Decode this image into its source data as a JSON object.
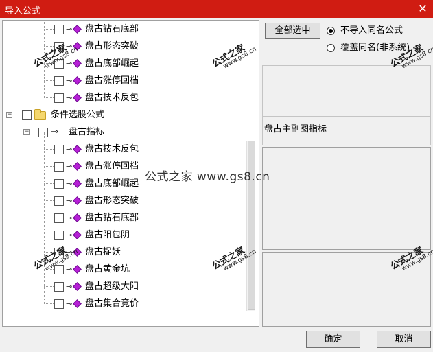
{
  "window": {
    "title": "导入公式",
    "close_glyph": "✕"
  },
  "tree": {
    "group1_items": [
      "盘古钻石底部",
      "盘古形态突破",
      "盘古底部崛起",
      "盘古涨停回档",
      "盘古技术反包"
    ],
    "folder_label": "条件选股公式",
    "subfolder_label": "盘古指标",
    "group2_items": [
      "盘古技术反包",
      "盘古涨停回档",
      "盘古底部崛起",
      "盘古形态突破",
      "盘古钻石底部",
      "盘古阳包阴",
      "盘古捉妖",
      "盘古黄金坑",
      "盘古超级大阳",
      "盘古集合竞价"
    ],
    "expander_collapse": "−"
  },
  "options": {
    "select_all": "全部选中",
    "radio_skip_same_name": "不导入同名公式",
    "radio_overwrite_same_name": "覆盖同名(非系统)",
    "selected": "radio_skip_same_name"
  },
  "description": {
    "text": "盘古主副图指标"
  },
  "watermark": {
    "brand": "公式之家",
    "url": "www.gs8.cn",
    "center_text": "公式之家 www.gs8.cn"
  },
  "buttons": {
    "ok": "确定",
    "cancel": "取消"
  },
  "colors": {
    "titlebar": "#d01c12",
    "diamond": "#b51fd6",
    "folder": "#f5d76e"
  }
}
